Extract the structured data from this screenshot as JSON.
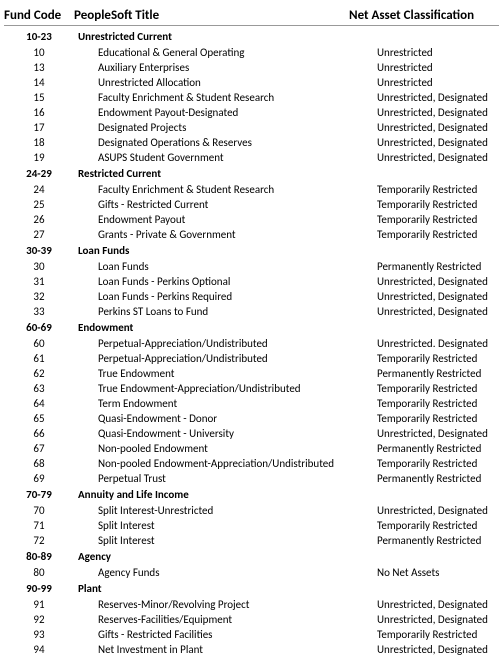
{
  "headers": {
    "code": "Fund Code",
    "title": "PeopleSoft Title",
    "classification": "Net Asset Classification"
  },
  "sections": [
    {
      "range": "10-23",
      "label": "Unrestricted Current",
      "rows": [
        {
          "code": "10",
          "title": "Educational & General Operating",
          "classification": "Unrestricted"
        },
        {
          "code": "13",
          "title": "Auxiliary Enterprises",
          "classification": "Unrestricted"
        },
        {
          "code": "14",
          "title": "Unrestricted Allocation",
          "classification": "Unrestricted"
        },
        {
          "code": "15",
          "title": "Faculty Enrichment & Student Research",
          "classification": "Unrestricted, Designated"
        },
        {
          "code": "16",
          "title": "Endowment Payout-Designated",
          "classification": "Unrestricted, Designated"
        },
        {
          "code": "17",
          "title": "Designated Projects",
          "classification": "Unrestricted, Designated"
        },
        {
          "code": "18",
          "title": "Designated Operations & Reserves",
          "classification": "Unrestricted, Designated"
        },
        {
          "code": "19",
          "title": "ASUPS Student Government",
          "classification": "Unrestricted, Designated"
        }
      ]
    },
    {
      "range": "24-29",
      "label": "Restricted Current",
      "rows": [
        {
          "code": "24",
          "title": "Faculty Enrichment & Student Research",
          "classification": "Temporarily Restricted"
        },
        {
          "code": "25",
          "title": "Gifts - Restricted Current",
          "classification": "Temporarily Restricted"
        },
        {
          "code": "26",
          "title": "Endowment Payout",
          "classification": "Temporarily Restricted"
        },
        {
          "code": "27",
          "title": "Grants - Private & Government",
          "classification": "Temporarily Restricted"
        }
      ]
    },
    {
      "range": "30-39",
      "label": "Loan Funds",
      "rows": [
        {
          "code": "30",
          "title": "Loan Funds",
          "classification": "Permanently Restricted"
        },
        {
          "code": "31",
          "title": "Loan Funds - Perkins Optional",
          "classification": "Unrestricted, Designated"
        },
        {
          "code": "32",
          "title": "Loan Funds - Perkins Required",
          "classification": "Unrestricted, Designated"
        },
        {
          "code": "33",
          "title": "Perkins ST Loans to Fund",
          "classification": "Unrestricted, Designated"
        }
      ]
    },
    {
      "range": "60-69",
      "label": "Endowment",
      "rows": [
        {
          "code": "60",
          "title": "Perpetual-Appreciation/Undistributed",
          "classification": "Unrestricted. Designated"
        },
        {
          "code": "61",
          "title": "Perpetual-Appreciation/Undistributed",
          "classification": "Temporarily Restricted"
        },
        {
          "code": "62",
          "title": "True Endowment",
          "classification": "Permanently Restricted"
        },
        {
          "code": "63",
          "title": "True Endowment-Appreciation/Undistributed",
          "classification": "Temporarily Restricted"
        },
        {
          "code": "64",
          "title": "Term Endowment",
          "classification": "Temporarily Restricted"
        },
        {
          "code": "65",
          "title": "Quasi-Endowment - Donor",
          "classification": "Temporarily Restricted"
        },
        {
          "code": "66",
          "title": "Quasi-Endowment - University",
          "classification": "Unrestricted, Designated"
        },
        {
          "code": "67",
          "title": "Non-pooled Endowment",
          "classification": "Permanently Restricted"
        },
        {
          "code": "68",
          "title": "Non-pooled Endowment-Appreciation/Undistributed",
          "classification": "Temporarily Restricted"
        },
        {
          "code": "69",
          "title": "Perpetual Trust",
          "classification": "Permanently Restricted"
        }
      ]
    },
    {
      "range": "70-79",
      "label": "Annuity and Life Income",
      "rows": [
        {
          "code": "70",
          "title": "Split Interest-Unrestricted",
          "classification": "Unrestricted, Designated"
        },
        {
          "code": "71",
          "title": "Split Interest",
          "classification": "Temporarily Restricted"
        },
        {
          "code": "72",
          "title": "Split Interest",
          "classification": "Permanently Restricted"
        }
      ]
    },
    {
      "range": "80-89",
      "label": "Agency",
      "rows": [
        {
          "code": "80",
          "title": "Agency Funds",
          "classification": "No Net Assets"
        }
      ]
    },
    {
      "range": "90-99",
      "label": "Plant",
      "rows": [
        {
          "code": "91",
          "title": "Reserves-Minor/Revolving Project",
          "classification": "Unrestricted, Designated"
        },
        {
          "code": "92",
          "title": "Reserves-Facilities/Equipment",
          "classification": "Unrestricted, Designated"
        },
        {
          "code": "93",
          "title": "Gifts - Restricted Facilities",
          "classification": "Temporarily Restricted"
        },
        {
          "code": "94",
          "title": "Net Investment in Plant",
          "classification": "Unrestricted, Designated"
        }
      ]
    }
  ]
}
